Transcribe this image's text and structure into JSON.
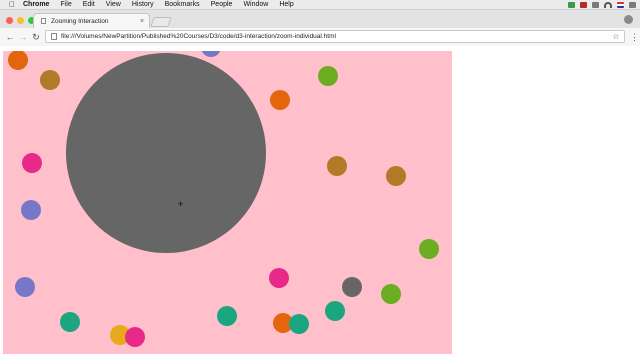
{
  "menubar": {
    "apple_icon": "apple-icon",
    "items": [
      "Chrome",
      "File",
      "Edit",
      "View",
      "History",
      "Bookmarks",
      "People",
      "Window",
      "Help"
    ]
  },
  "browser": {
    "tab_title": "Zooming Interaction",
    "tab_close": "×",
    "address": "file:///Volumes/NewPartition/Published%20Courses/D3/code/d3-interaction/zoom-individual.html",
    "nav_icons": {
      "back": "←",
      "forward": "→",
      "reload": "↻",
      "star": "☆",
      "menu": "⋮"
    }
  },
  "visualization": {
    "background": "#ffc0cb",
    "big_circle_color": "#666666",
    "colors": {
      "orange": "#e3650c",
      "brown": "#b07a27",
      "green": "#6cad22",
      "magenta": "#e8298a",
      "purple": "#7777c8",
      "gray": "#666666",
      "teal": "#1ba67f",
      "gold": "#e6aa1a"
    },
    "circles": [
      {
        "color": "purple"
      },
      {
        "color": "gold"
      },
      {
        "color": "orange"
      },
      {
        "color": "brown"
      },
      {
        "color": "green"
      },
      {
        "color": "orange"
      },
      {
        "color": "magenta"
      },
      {
        "color": "brown"
      },
      {
        "color": "brown"
      },
      {
        "color": "purple"
      },
      {
        "color": "green"
      },
      {
        "color": "magenta"
      },
      {
        "color": "purple"
      },
      {
        "color": "gray"
      },
      {
        "color": "green"
      },
      {
        "color": "teal"
      },
      {
        "color": "teal"
      },
      {
        "color": "teal"
      },
      {
        "color": "orange"
      },
      {
        "color": "teal"
      },
      {
        "color": "gold"
      },
      {
        "color": "magenta"
      }
    ]
  }
}
